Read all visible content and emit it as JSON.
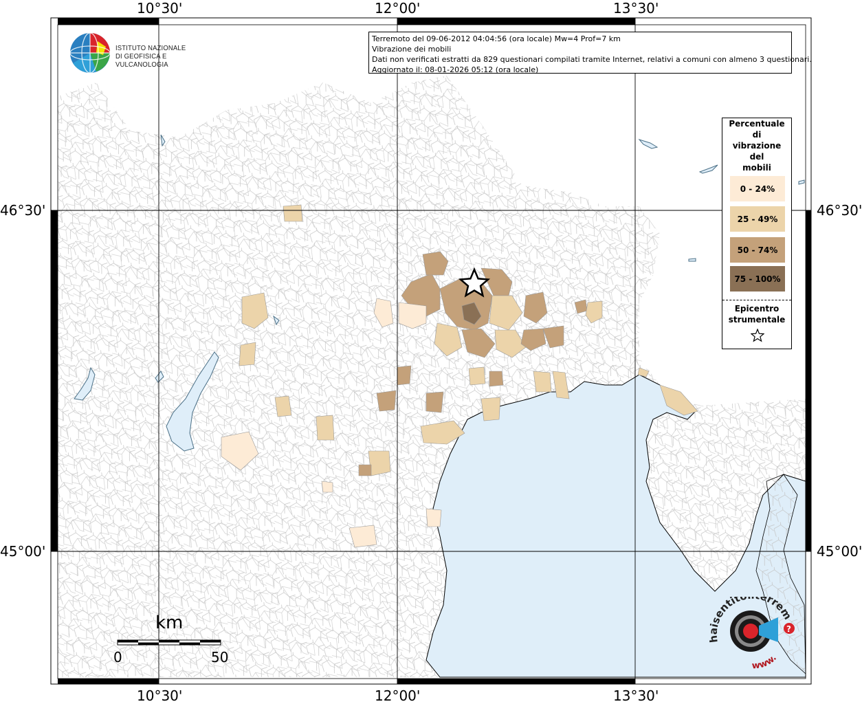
{
  "map": {
    "lon_labels_top": [
      "10°30'",
      "12°00'",
      "13°30'"
    ],
    "lon_labels_bottom": [
      "10°30'",
      "12°00'",
      "13°30'"
    ],
    "lat_labels_left": [
      "46°30'",
      "45°00'"
    ],
    "lat_labels_right": [
      "46°30'",
      "45°00'"
    ],
    "sea_color": "#dfeef9",
    "boundary_color": "#b8b8b8"
  },
  "info": {
    "line1": "Terremoto del 09-06-2012 04:04:56 (ora locale) Mw=4 Prof=7 km",
    "line2": "Vibrazione dei mobili",
    "line3": "Dati non verificati estratti da 829 questionari compilati tramite Internet, relativi a comuni con almeno 3 questionari.",
    "line4": "Aggiornato il: 08-01-2026 05:12 (ora locale)"
  },
  "logo": {
    "line1": "ISTITUTO NAZIONALE",
    "line2": "DI GEOFISICA E VULCANOLOGIA"
  },
  "legend": {
    "title_lines": [
      "Percentuale",
      "di",
      "vibrazione",
      "del",
      "mobili"
    ],
    "items": [
      {
        "label": "0 - 24%",
        "color": "#fdebd6"
      },
      {
        "label": "25 - 49%",
        "color": "#ecd4aa"
      },
      {
        "label": "50 - 74%",
        "color": "#c4a17a"
      },
      {
        "label": "75 - 100%",
        "color": "#8a7055"
      }
    ],
    "epicenter_lines": [
      "Epicentro",
      "strumentale"
    ]
  },
  "scale": {
    "unit": "km",
    "start": "0",
    "end": "50"
  },
  "badge": {
    "text": "haisentitoilterremoto.it",
    "www": "www.",
    "question": "?"
  }
}
